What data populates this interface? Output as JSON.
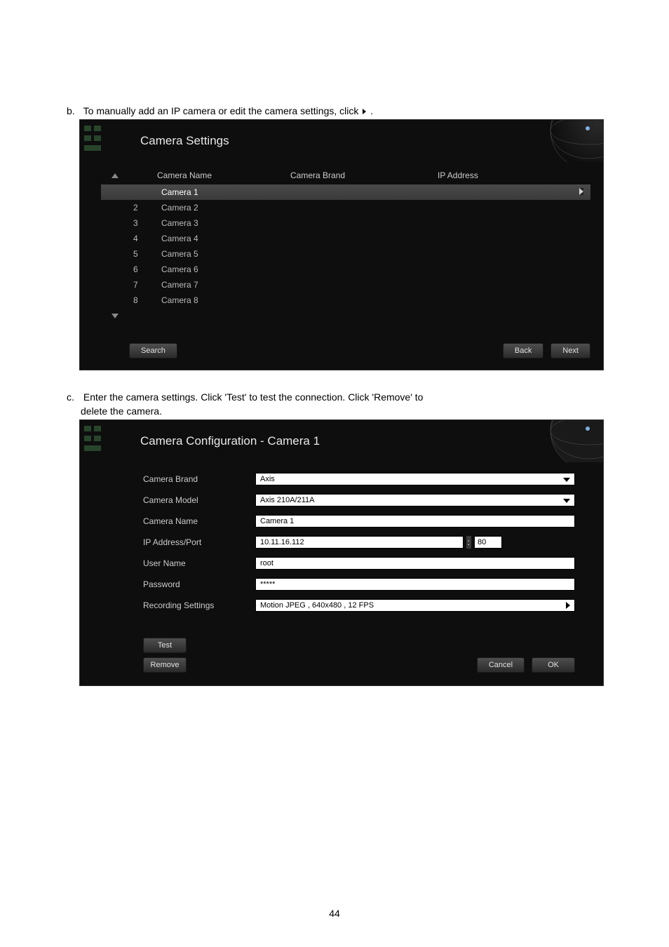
{
  "intro_b": {
    "letter": "b.",
    "text_before": "To manually add an IP camera or edit the camera settings, click ",
    "text_after": "."
  },
  "settings_panel": {
    "title": "Camera Settings",
    "headers": {
      "name": "Camera Name",
      "brand": "Camera Brand",
      "ip": "IP Address"
    },
    "rows": [
      {
        "idx": "",
        "name": "Camera 1",
        "selected": true,
        "has_arrow": true
      },
      {
        "idx": "2",
        "name": "Camera 2",
        "selected": false,
        "has_arrow": false
      },
      {
        "idx": "3",
        "name": "Camera 3",
        "selected": false,
        "has_arrow": false
      },
      {
        "idx": "4",
        "name": "Camera 4",
        "selected": false,
        "has_arrow": false
      },
      {
        "idx": "5",
        "name": "Camera 5",
        "selected": false,
        "has_arrow": false
      },
      {
        "idx": "6",
        "name": "Camera 6",
        "selected": false,
        "has_arrow": false
      },
      {
        "idx": "7",
        "name": "Camera 7",
        "selected": false,
        "has_arrow": false
      },
      {
        "idx": "8",
        "name": "Camera 8",
        "selected": false,
        "has_arrow": false
      }
    ],
    "buttons": {
      "search": "Search",
      "back": "Back",
      "next": "Next"
    }
  },
  "intro_c": {
    "letter": "c.",
    "line1": "Enter the camera settings.   Click 'Test' to test the connection.   Click 'Remove' to",
    "line2": "delete the camera."
  },
  "config_panel": {
    "title": "Camera Configuration - Camera 1",
    "fields": {
      "brand_label": "Camera Brand",
      "brand_value": "Axis",
      "model_label": "Camera Model",
      "model_value": "Axis 210A/211A",
      "name_label": "Camera Name",
      "name_value": "Camera 1",
      "ipport_label": "IP Address/Port",
      "ip_value": "10.11.16.112",
      "port_value": "80",
      "user_label": "User Name",
      "user_value": "root",
      "pass_label": "Password",
      "pass_value": "*****",
      "rec_label": "Recording Settings",
      "rec_value": "Motion JPEG , 640x480 , 12 FPS"
    },
    "buttons": {
      "test": "Test",
      "remove": "Remove",
      "cancel": "Cancel",
      "ok": "OK"
    }
  },
  "page_number": "44"
}
